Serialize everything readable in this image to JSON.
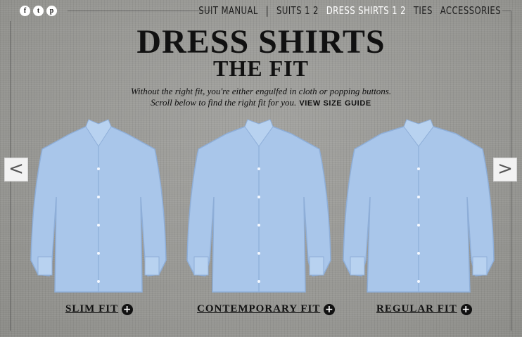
{
  "social": [
    {
      "icon": "facebook-icon",
      "glyph": "f"
    },
    {
      "icon": "twitter-icon",
      "glyph": "t"
    },
    {
      "icon": "pinterest-icon",
      "glyph": "p"
    }
  ],
  "nav": {
    "suit_manual": "SUIT MANUAL",
    "separator": "|",
    "suits": "SUITS 1 2",
    "dress_shirts": "DRESS SHIRTS 1 2",
    "ties": "TIES",
    "accessories": "ACCESSORIES"
  },
  "page": {
    "title": "DRESS SHIRTS",
    "subtitle": "THE FIT",
    "intro_line1": "Without the right fit, you're either engulfed in cloth or popping buttons.",
    "intro_line2": "Scroll below to find the right fit for you.",
    "size_guide": "VIEW SIZE GUIDE"
  },
  "carousel": {
    "prev_glyph": "<",
    "next_glyph": ">"
  },
  "fits": [
    {
      "label": "SLIM FIT",
      "plus": "+"
    },
    {
      "label": "CONTEMPORARY FIT",
      "plus": "+"
    },
    {
      "label": "REGULAR FIT",
      "plus": "+"
    }
  ],
  "colors": {
    "shirt_blue": "#a9c6ea",
    "shirt_shadow": "#8eaed8",
    "background": "#9a9a96",
    "active_nav": "#ffffff"
  }
}
